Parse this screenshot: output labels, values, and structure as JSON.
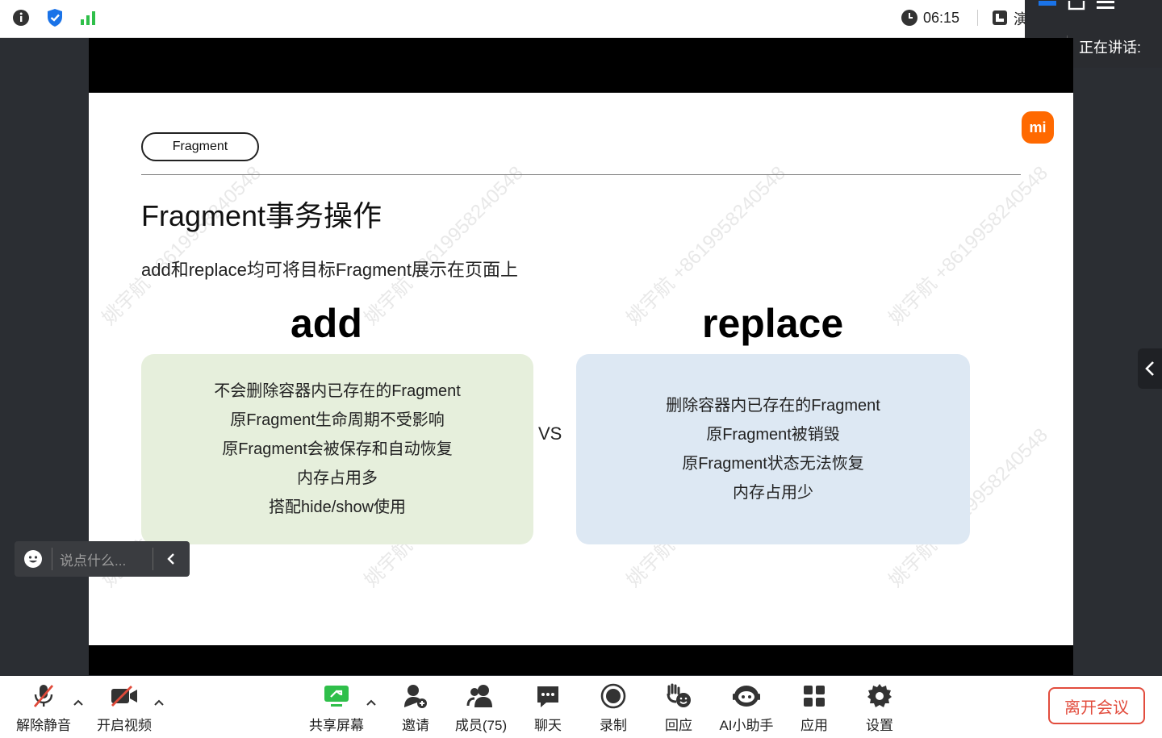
{
  "topbar": {
    "time": "06:15",
    "present_label": "演"
  },
  "speaker_panel": {
    "label": "正在讲话:"
  },
  "slide": {
    "tag": "Fragment",
    "logo": "mi",
    "title": "Fragment事务操作",
    "subtitle": "add和replace均可将目标Fragment展示在页面上",
    "left_heading": "add",
    "right_heading": "replace",
    "vs": "VS",
    "add_lines": [
      "不会删除容器内已存在的Fragment",
      "原Fragment生命周期不受影响",
      "原Fragment会被保存和自动恢复",
      "内存占用多",
      "搭配hide/show使用"
    ],
    "replace_lines": [
      "删除容器内已存在的Fragment",
      "原Fragment被销毁",
      "原Fragment状态无法恢复",
      "内存占用少"
    ],
    "watermark": "姚宇航 +8619958240548"
  },
  "chat": {
    "placeholder": "说点什么..."
  },
  "toolbar": {
    "unmute": "解除静音",
    "start_video": "开启视频",
    "share_screen": "共享屏幕",
    "invite": "邀请",
    "members": "成员(75)",
    "chat": "聊天",
    "record": "录制",
    "react": "回应",
    "ai_assistant": "AI小助手",
    "apps": "应用",
    "settings": "设置",
    "leave": "离开会议"
  },
  "colors": {
    "accent_blue": "#1a73e8",
    "signal_green": "#2fbf4a",
    "mi_orange": "#ff6900",
    "leave_red": "#e24c3d",
    "muted_red": "#e04a3a",
    "add_box": "#e6efdc",
    "replace_box": "#dde8f3"
  }
}
